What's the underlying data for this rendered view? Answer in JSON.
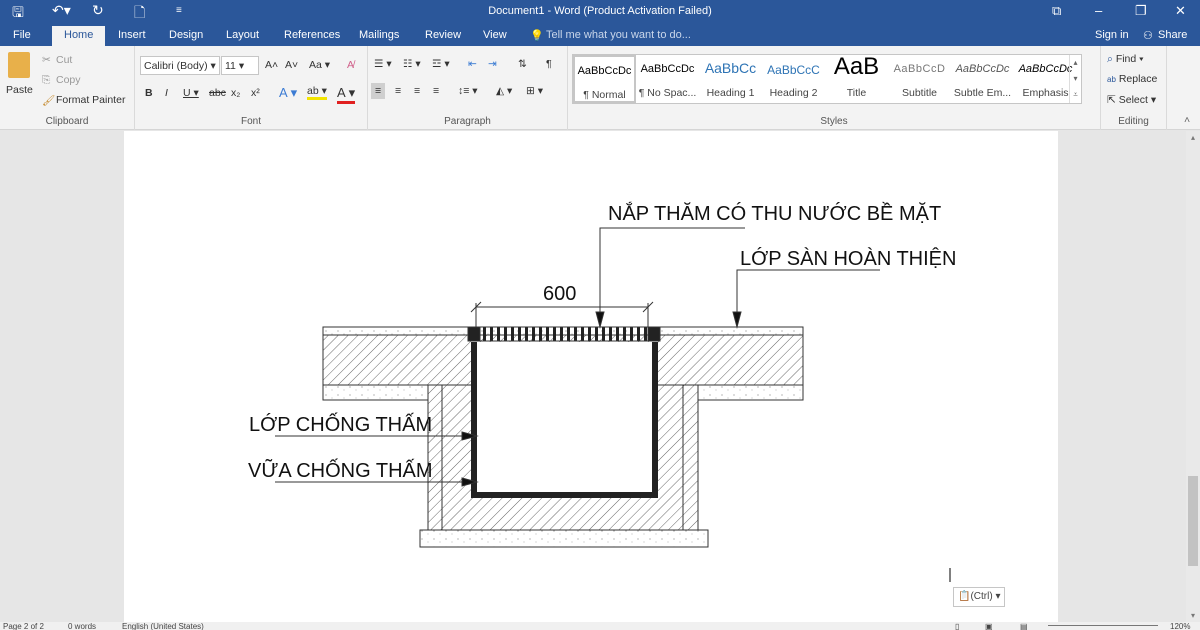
{
  "window": {
    "title": "Document1 - Word (Product Activation Failed)"
  },
  "tabs": [
    "File",
    "Home",
    "Insert",
    "Design",
    "Layout",
    "References",
    "Mailings",
    "Review",
    "View"
  ],
  "tell_me": "Tell me what you want to do...",
  "sign_in": "Sign in",
  "share": "Share",
  "clipboard": {
    "paste": "Paste",
    "cut": "Cut",
    "copy": "Copy",
    "format_painter": "Format Painter",
    "label": "Clipboard"
  },
  "font": {
    "name": "Calibri (Body)",
    "size": "11",
    "label": "Font",
    "case": "Aa"
  },
  "paragraph": {
    "label": "Paragraph"
  },
  "styles": {
    "label": "Styles",
    "items": [
      {
        "preview": "AaBbCcDc",
        "name": "¶ Normal"
      },
      {
        "preview": "AaBbCcDc",
        "name": "¶ No Spac..."
      },
      {
        "preview": "AaBbCc",
        "name": "Heading 1"
      },
      {
        "preview": "AaBbCcC",
        "name": "Heading 2"
      },
      {
        "preview": "AaB",
        "name": "Title"
      },
      {
        "preview": "AaBbCcD",
        "name": "Subtitle"
      },
      {
        "preview": "AaBbCcDc",
        "name": "Subtle Em..."
      },
      {
        "preview": "AaBbCcDc",
        "name": "Emphasis"
      }
    ]
  },
  "editing": {
    "find": "Find",
    "replace": "Replace",
    "select": "Select",
    "label": "Editing"
  },
  "drawing": {
    "cover": "NẮP THĂM CÓ THU NƯỚC BỀ MẶT",
    "finish": "LỚP SÀN HOÀN THIỆN",
    "dimension": "600",
    "waterproof_layer": "LỚP CHỐNG THẤM",
    "waterproof_mortar": "VỮA CHỐNG THẤM"
  },
  "paste_options": "(Ctrl)",
  "status": {
    "page": "Page 2 of 2",
    "words": "0 words",
    "language": "English (United States)",
    "zoom": "120%"
  }
}
